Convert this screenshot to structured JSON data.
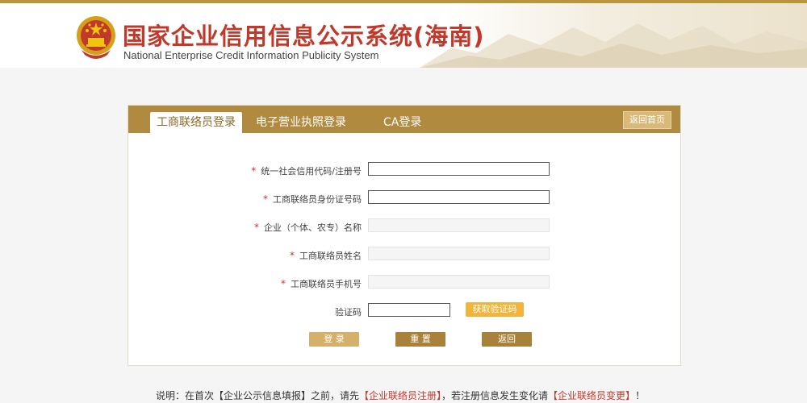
{
  "header": {
    "title_cn": "国家企业信用信息公示系统(海南)",
    "title_en": "National Enterprise Credit Information Publicity System"
  },
  "tabs": [
    {
      "label": "工商联络员登录",
      "active": true
    },
    {
      "label": "电子营业执照登录",
      "active": false
    },
    {
      "label": "CA登录",
      "active": false
    }
  ],
  "home_button": "返回首页",
  "form": {
    "fields": [
      {
        "label": "统一社会信用代码/注册号",
        "required": true,
        "value": "",
        "readonly": false
      },
      {
        "label": "工商联络员身份证号码",
        "required": true,
        "value": "",
        "readonly": false
      },
      {
        "label": "企业（个体、农专）名称",
        "required": true,
        "value": "",
        "readonly": true
      },
      {
        "label": "工商联络员姓名",
        "required": true,
        "value": "",
        "readonly": true
      },
      {
        "label": "工商联络员手机号",
        "required": true,
        "value": "",
        "readonly": true
      }
    ],
    "required_mark": "*",
    "captcha": {
      "label": "验证码",
      "value": "",
      "button": "获取验证码"
    },
    "buttons": {
      "login": "登 录",
      "reset": "重 置",
      "back": "返回"
    }
  },
  "note": {
    "prefix": "说明：在首次【企业公示信息填报】之前，请先",
    "link1": "【企业联络员注册】",
    "middle": "，若注册信息发生变化请",
    "link2": "【企业联络员变更】",
    "suffix": "！"
  },
  "colors": {
    "brand_gold": "#b08a3e",
    "title_red": "#c0392b",
    "login_button": "#d4b06a",
    "action_button": "#a8823a",
    "captcha_button": "#f0b53a"
  }
}
